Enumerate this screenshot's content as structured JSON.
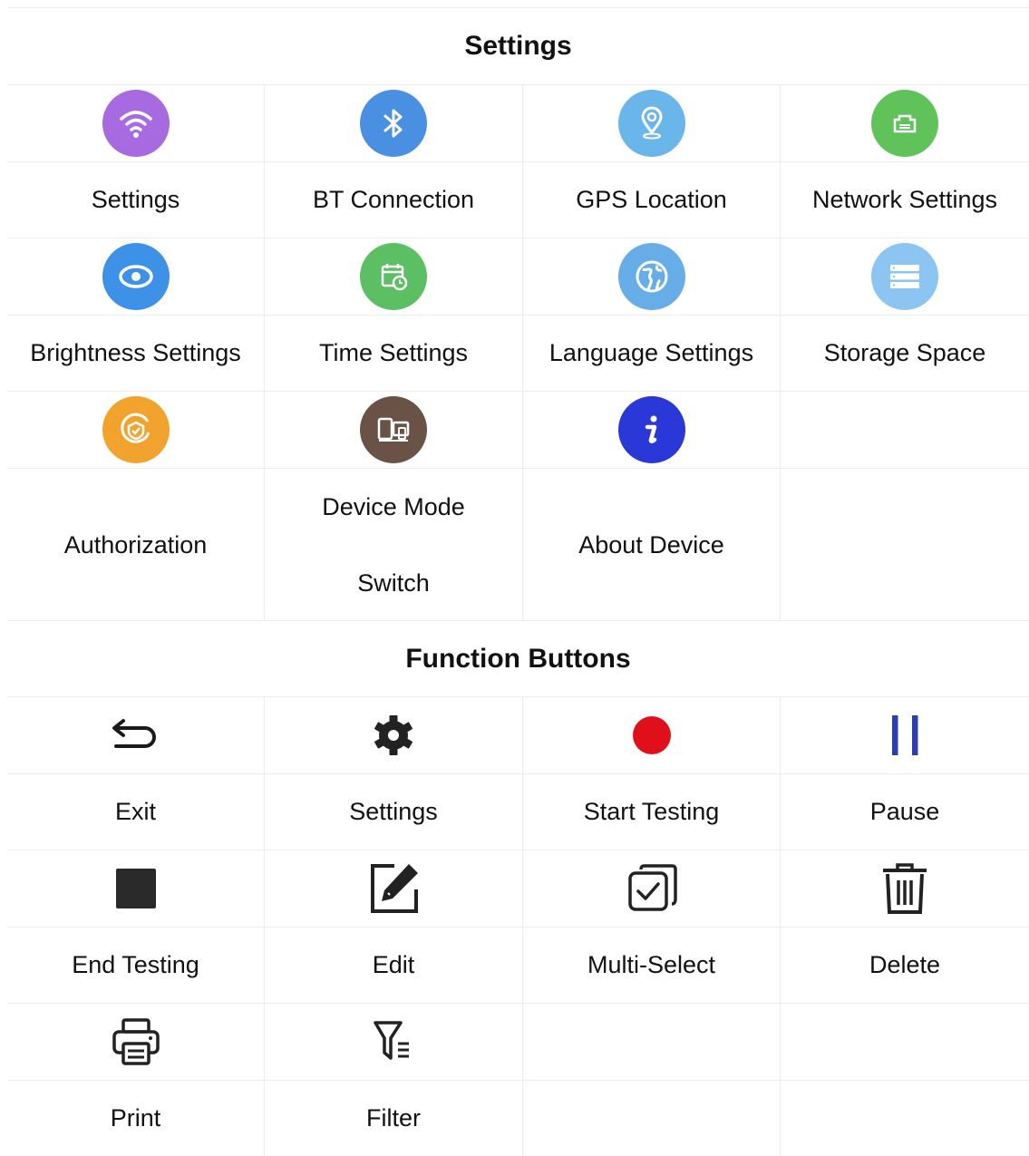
{
  "settings_section": {
    "title": "Settings",
    "rows": [
      {
        "icons": [
          {
            "name": "wifi-icon",
            "color": "#a86ae0"
          },
          {
            "name": "bluetooth-icon",
            "color": "#4a90e2"
          },
          {
            "name": "location-pin-icon",
            "color": "#6ab5ea"
          },
          {
            "name": "ethernet-icon",
            "color": "#5fc35a"
          }
        ],
        "labels": [
          "Settings",
          "BT Connection",
          "GPS Location",
          "Network Settings"
        ]
      },
      {
        "icons": [
          {
            "name": "eye-icon",
            "color": "#3d92e8"
          },
          {
            "name": "calendar-clock-icon",
            "color": "#5cbf63"
          },
          {
            "name": "globe-icon",
            "color": "#67aee8"
          },
          {
            "name": "storage-icon",
            "color": "#8cc4f2"
          }
        ],
        "labels": [
          "Brightness Settings",
          "Time Settings",
          "Language Settings",
          "Storage Space"
        ]
      },
      {
        "icons": [
          {
            "name": "authorization-icon",
            "color": "#f2a32e"
          },
          {
            "name": "device-switch-icon",
            "color": "#6b5247"
          },
          {
            "name": "info-icon",
            "color": "#2a38d8"
          }
        ],
        "labels": [
          "Authorization",
          [
            "Device Mode",
            "Switch"
          ],
          "About Device",
          ""
        ]
      }
    ]
  },
  "function_section": {
    "title": "Function Buttons",
    "rows": [
      {
        "icons": [
          {
            "name": "exit-icon",
            "color": "#1a1a1a"
          },
          {
            "name": "gear-icon",
            "color": "#222222"
          },
          {
            "name": "record-icon",
            "color": "#e0101a"
          },
          {
            "name": "pause-icon",
            "color": "#2c3fb0"
          }
        ],
        "labels": [
          "Exit",
          "Settings",
          "Start Testing",
          "Pause"
        ]
      },
      {
        "icons": [
          {
            "name": "stop-icon",
            "color": "#2a2a2a"
          },
          {
            "name": "edit-icon",
            "color": "#222222"
          },
          {
            "name": "multi-select-icon",
            "color": "#222222"
          },
          {
            "name": "trash-icon",
            "color": "#222222"
          }
        ],
        "labels": [
          "End Testing",
          "Edit",
          "Multi-Select",
          "Delete"
        ]
      },
      {
        "icons": [
          {
            "name": "printer-icon",
            "color": "#222222"
          },
          {
            "name": "filter-icon",
            "color": "#222222"
          }
        ],
        "labels": [
          "Print",
          "Filter",
          "",
          ""
        ]
      }
    ]
  }
}
